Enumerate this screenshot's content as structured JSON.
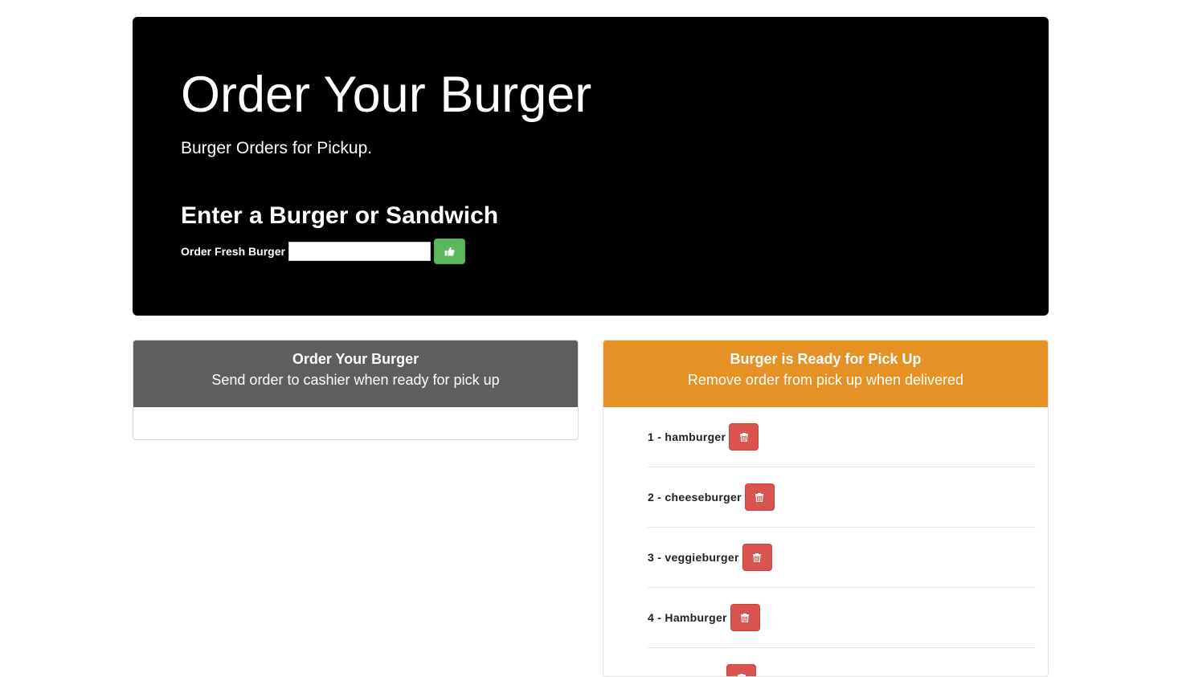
{
  "jumbotron": {
    "title": "Order Your Burger",
    "subtitle": "Burger Orders for Pickup.",
    "form_heading": "Enter a Burger or Sandwich",
    "form_label": "Order Fresh Burger",
    "input_value": "",
    "input_placeholder": "",
    "submit_icon": "thumbs-up-icon"
  },
  "panels": {
    "left": {
      "title": "Order Your Burger",
      "subtitle": "Send order to cashier when ready for pick up",
      "items": []
    },
    "right": {
      "title": "Burger is Ready for Pick Up",
      "subtitle": "Remove order from pick up when delivered",
      "delete_icon": "trash-icon",
      "items": [
        {
          "label": "1 - hamburger"
        },
        {
          "label": "2 - cheeseburger"
        },
        {
          "label": "3 - veggieburger"
        },
        {
          "label": "4 - Hamburger"
        },
        {
          "label": ""
        }
      ]
    }
  },
  "colors": {
    "jumbotron_bg": "#000000",
    "success": "#5cb85c",
    "danger": "#d9534f",
    "left_heading": "#5e5e5e",
    "right_heading": "#e69125"
  }
}
